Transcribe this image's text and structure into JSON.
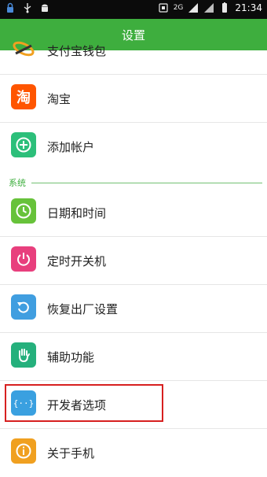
{
  "status_bar": {
    "time": "21:34",
    "network": "2G",
    "icons": [
      "lock-icon",
      "usb-icon",
      "android-icon",
      "sim-icon",
      "signal-icon",
      "battery-icon"
    ]
  },
  "header": {
    "title": "设置"
  },
  "sections": {
    "system_label": "系统"
  },
  "items": [
    {
      "key": "alipay",
      "label": "支付宝钱包",
      "icon": "alipay-icon",
      "color": "#f0a020"
    },
    {
      "key": "taobao",
      "label": "淘宝",
      "icon": "taobao-icon",
      "color": "#ff5500"
    },
    {
      "key": "add_account",
      "label": "添加帐户",
      "icon": "add-icon",
      "color": "#2cbf7a"
    },
    {
      "key": "datetime",
      "label": "日期和时间",
      "icon": "clock-icon",
      "color": "#67c23a"
    },
    {
      "key": "power_schedule",
      "label": "定时开关机",
      "icon": "power-icon",
      "color": "#e83f7d"
    },
    {
      "key": "factory_reset",
      "label": "恢复出厂设置",
      "icon": "reset-icon",
      "color": "#409ee0"
    },
    {
      "key": "accessibility",
      "label": "辅助功能",
      "icon": "hand-icon",
      "color": "#25b07c"
    },
    {
      "key": "developer",
      "label": "开发者选项",
      "icon": "code-icon",
      "color": "#3aa0e0"
    },
    {
      "key": "about",
      "label": "关于手机",
      "icon": "info-icon",
      "color": "#f0a020"
    }
  ]
}
